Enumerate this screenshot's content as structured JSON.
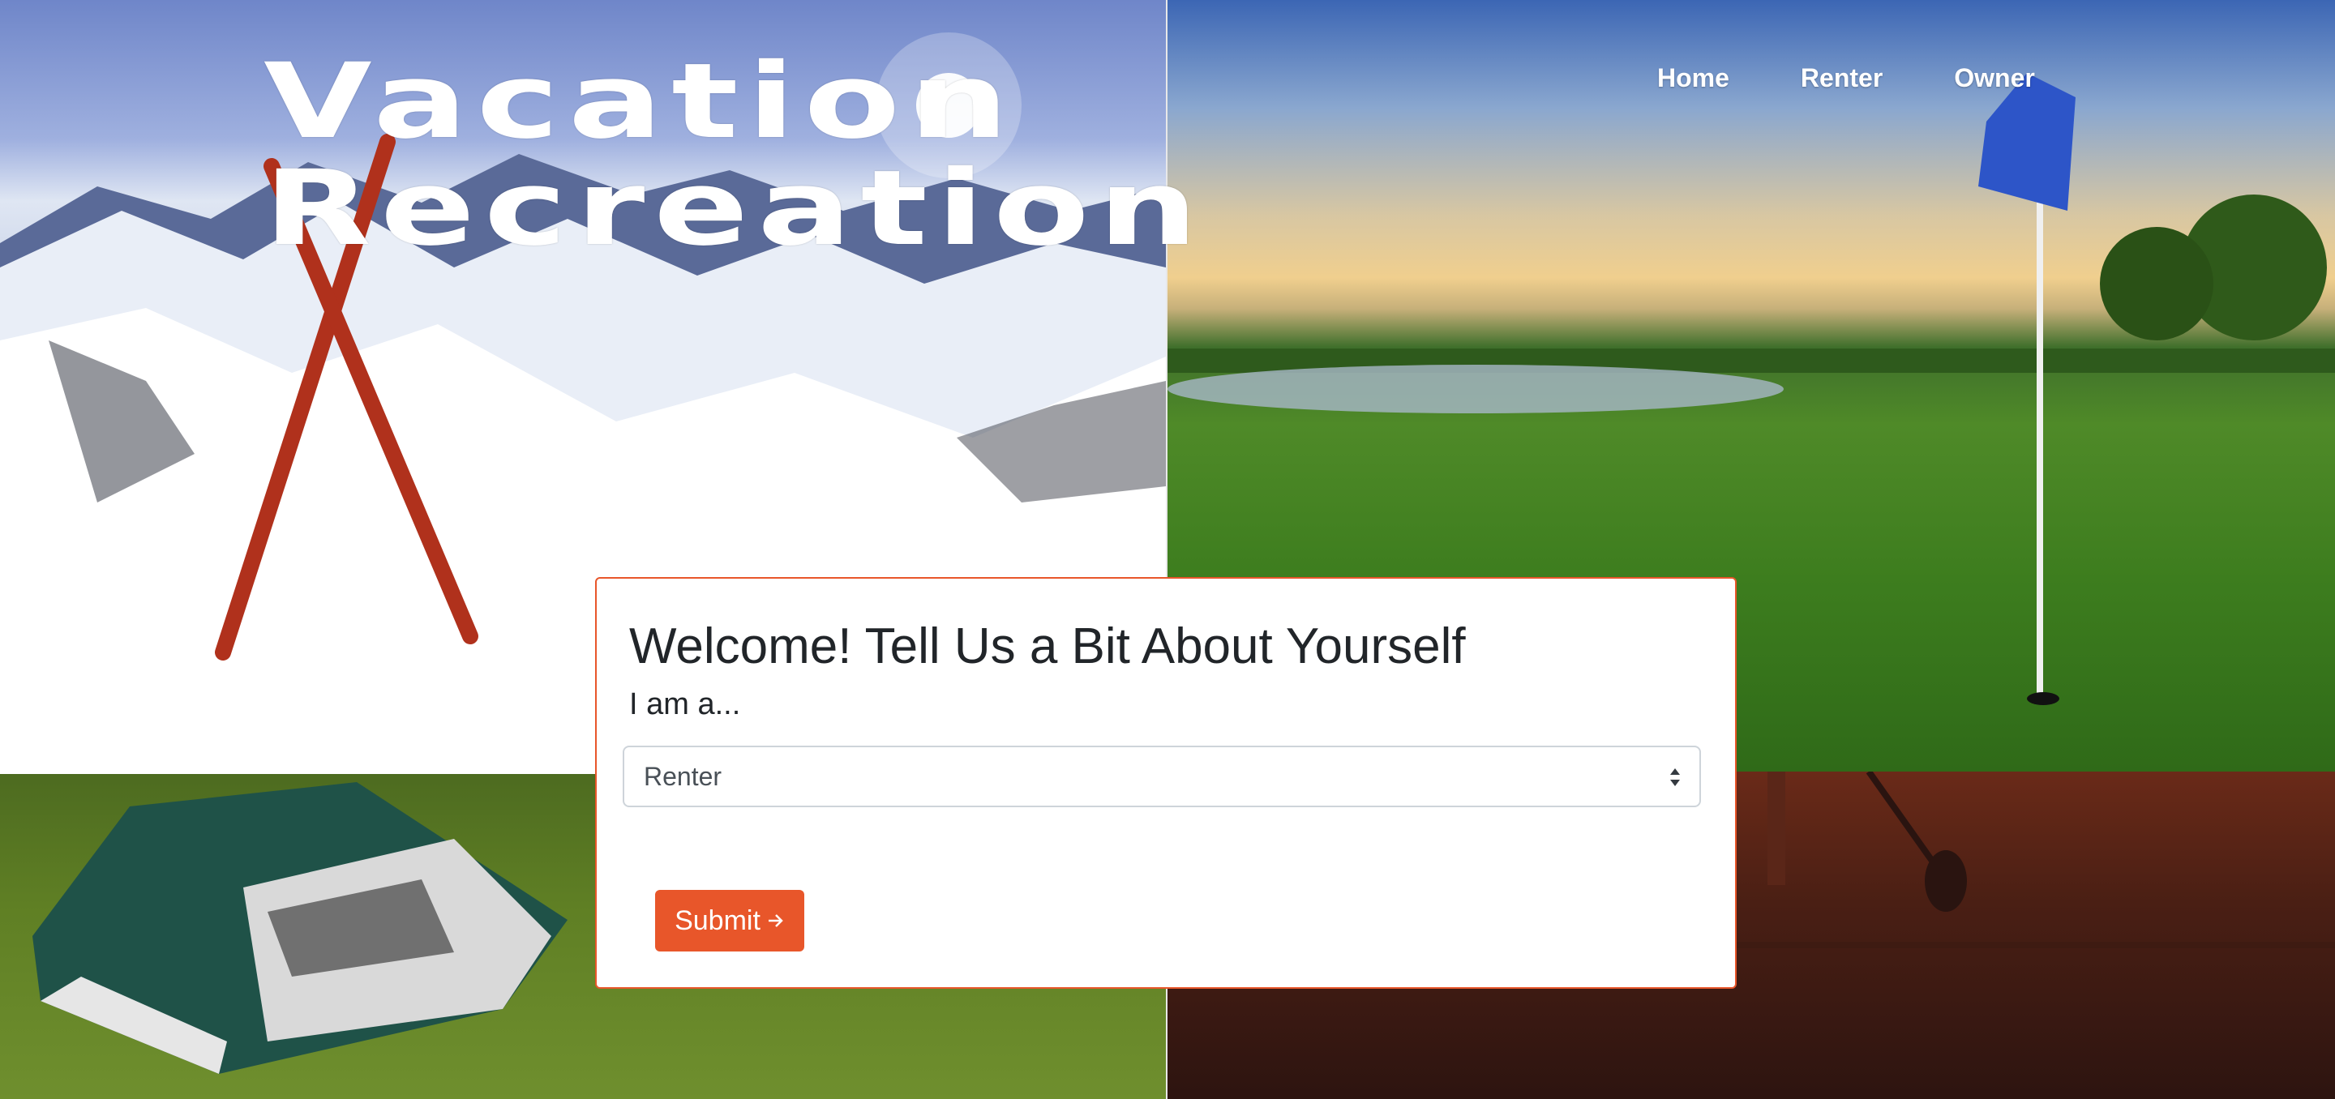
{
  "site": {
    "title_line1": "Vacation",
    "title_line2": "Recreation"
  },
  "nav": {
    "items": [
      {
        "label": "Home"
      },
      {
        "label": "Renter"
      },
      {
        "label": "Owner"
      }
    ]
  },
  "form": {
    "heading": "Welcome! Tell Us a Bit About Yourself",
    "role_label": "I am a...",
    "role_selected": "Renter",
    "submit_label": "Submit",
    "submit_icon": "arrow-right-icon"
  },
  "colors": {
    "accent": "#e8562a",
    "text": "#212529"
  }
}
